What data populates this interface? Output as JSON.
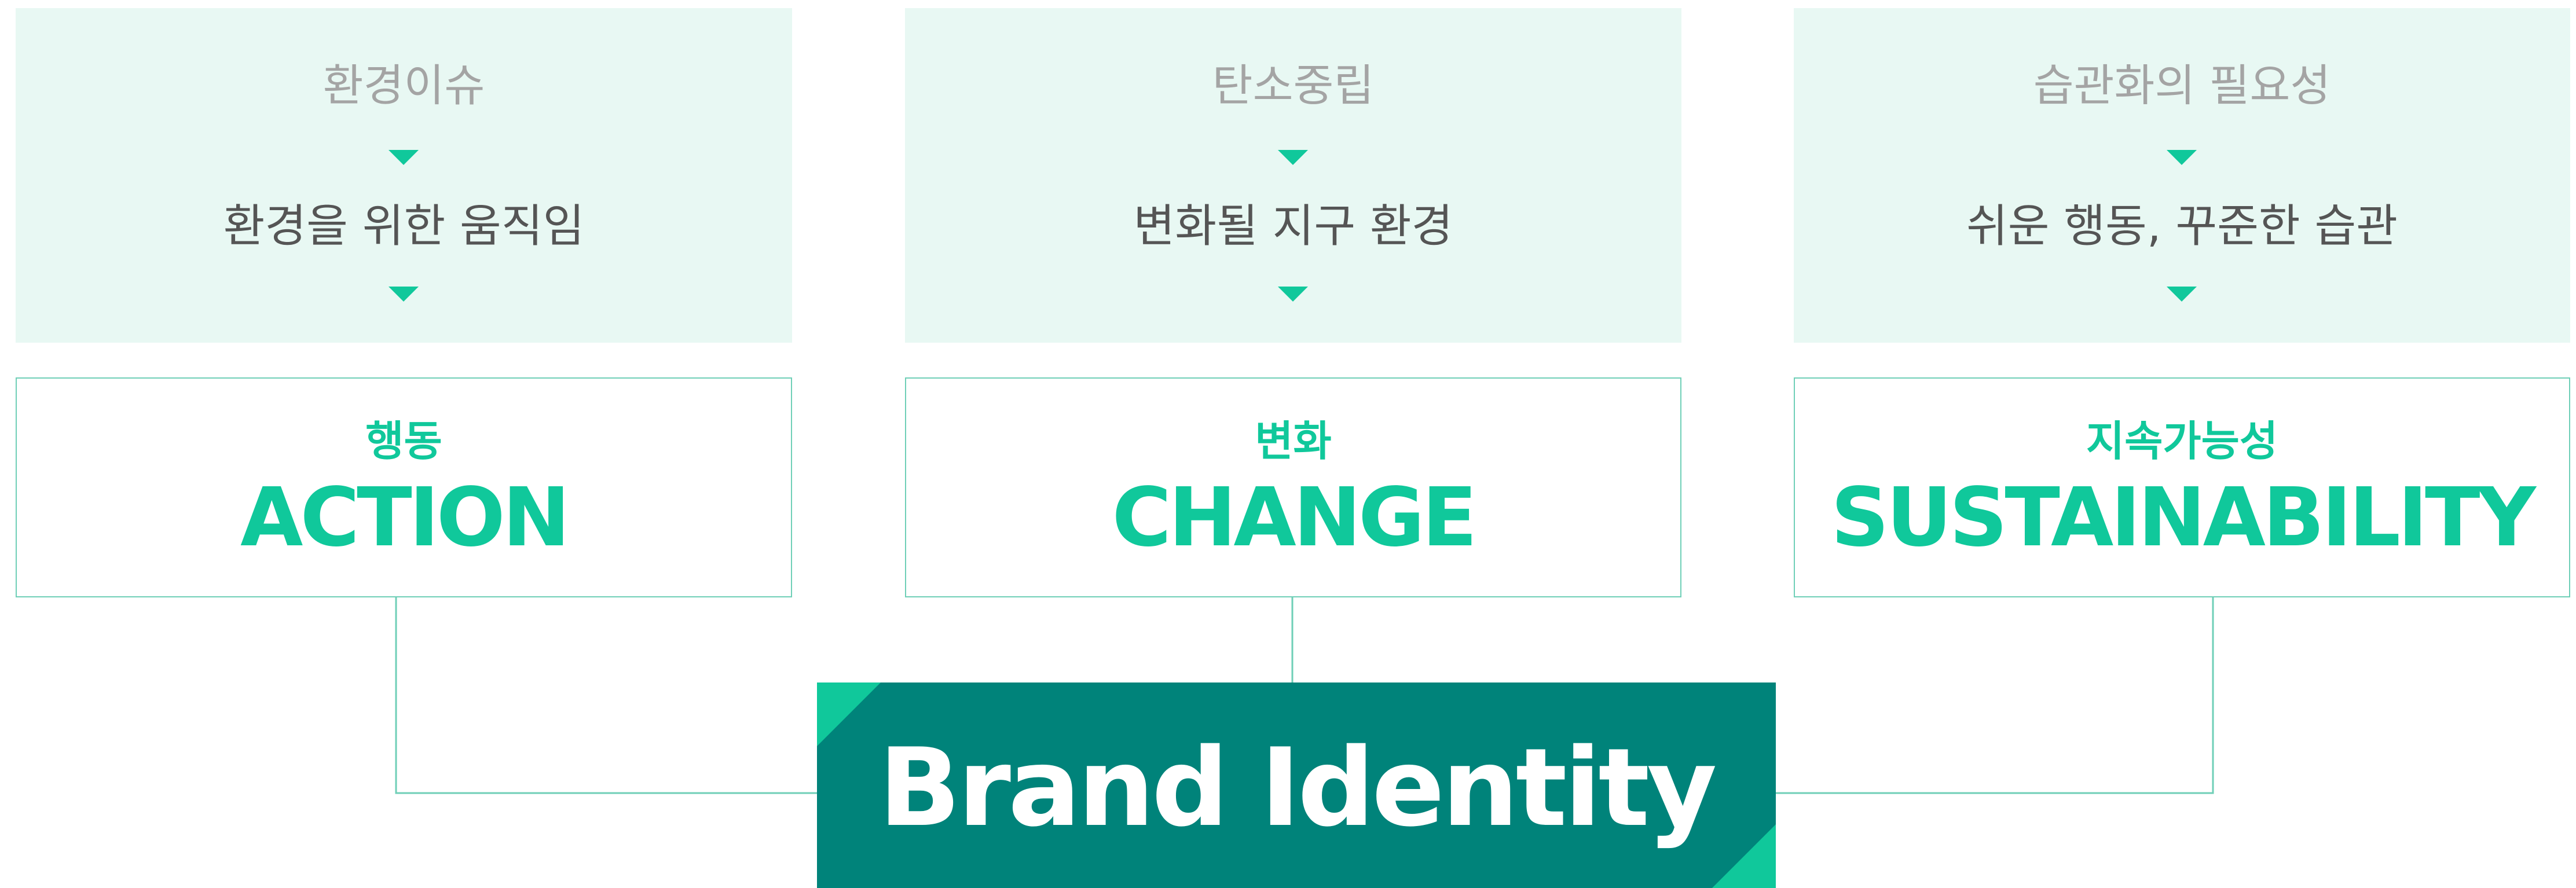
{
  "colors": {
    "accent": "#10c89b",
    "brand": "#00837a",
    "panel": "#e8f8f3",
    "line": "#6fcfb7"
  },
  "pillars": [
    {
      "issue": "환경이슈",
      "issue_detail": "환경을 위한 움직임",
      "value_ko": "행동",
      "value_en": "ACTION"
    },
    {
      "issue": "탄소중립",
      "issue_detail": "변화될 지구 환경",
      "value_ko": "변화",
      "value_en": "CHANGE"
    },
    {
      "issue": "습관화의 필요성",
      "issue_detail": "쉬운 행동, 꾸준한 습관",
      "value_ko": "지속가능성",
      "value_en": "SUSTAINABILITY"
    }
  ],
  "brand": {
    "title": "Brand Identity"
  },
  "icons": {
    "flow_arrow": "down-triangle-icon",
    "corner_accent": "corner-triangle-accent"
  }
}
